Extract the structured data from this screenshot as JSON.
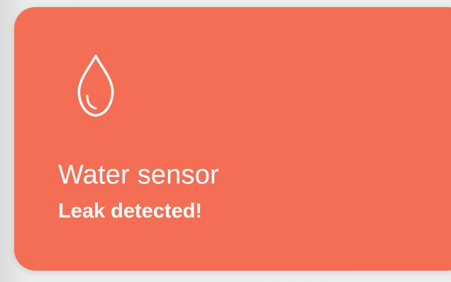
{
  "card": {
    "icon": "water-drop-icon",
    "title": "Water sensor",
    "status": "Leak detected!",
    "accent_color": "#f36e55",
    "text_color": "#ffffff"
  }
}
